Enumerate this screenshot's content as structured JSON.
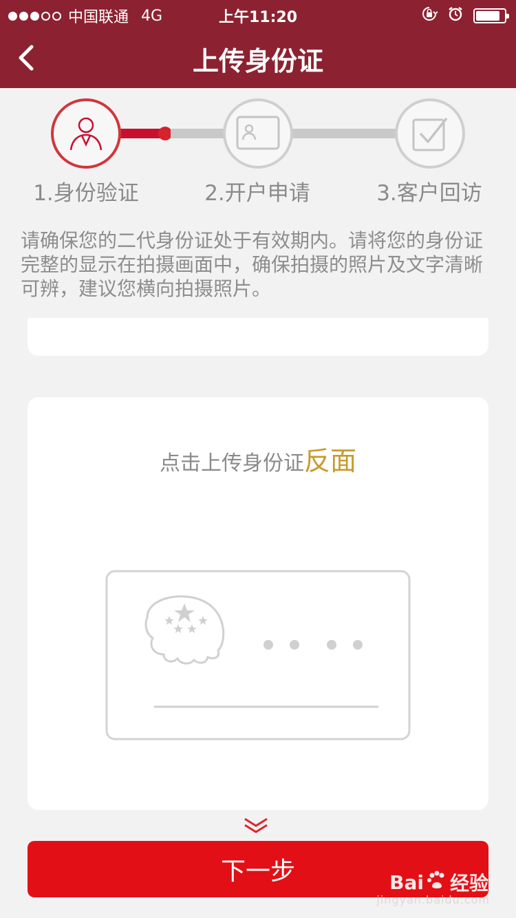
{
  "status_bar": {
    "carrier": "中国联通",
    "network": "4G",
    "time": "上午11:20",
    "signal_bars_filled": 3,
    "signal_bars_total": 5,
    "battery_level": 0.85
  },
  "header": {
    "title": "上传身份证",
    "back_icon": "chevron-left-icon"
  },
  "steps": [
    {
      "label": "1.身份验证",
      "icon": "person-icon",
      "state": "active"
    },
    {
      "label": "2.开户申请",
      "icon": "id-card-icon",
      "state": "inactive"
    },
    {
      "label": "3.客户回访",
      "icon": "checkbox-icon",
      "state": "inactive"
    }
  ],
  "instructions": "请确保您的二代身份证处于有效期内。请将您的身份证完整的显示在拍摄画面中，确保拍摄的照片及文字清晰可辨，建议您横向拍摄照片。",
  "upload_back": {
    "prefix": "点击上传身份证",
    "highlight": "反面"
  },
  "next_button": {
    "label": "下一步"
  },
  "watermark": {
    "brand": "Bai",
    "brand_suffix": "经验",
    "url": "jingyan.baidu.com"
  },
  "colors": {
    "header_bg": "#8c2231",
    "accent_red": "#e20f16",
    "highlight_gold": "#c89a2a"
  }
}
